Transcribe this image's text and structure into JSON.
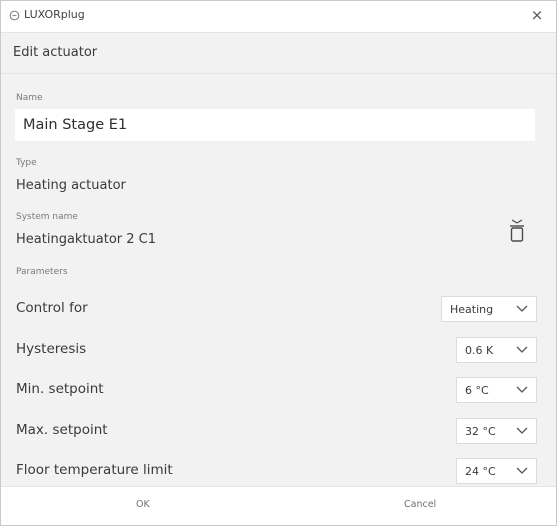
{
  "window": {
    "title": "LUXORplug",
    "close_glyph": "×",
    "app_icon": "luxorplug-icon",
    "close_icon": "close-icon"
  },
  "dialog": {
    "title": "Edit actuator"
  },
  "form": {
    "name_label": "Name",
    "name_value": "Main Stage E1",
    "type_label": "Type",
    "type_value": "Heating actuator",
    "system_name_label": "System name",
    "system_name_value": "Heatingaktuator 2 C1",
    "delete_icon": "trash-icon"
  },
  "parameters": {
    "label": "Parameters",
    "rows": [
      {
        "label": "Control for",
        "value": "Heating"
      },
      {
        "label": "Hysteresis",
        "value": "0.6 K"
      },
      {
        "label": "Min. setpoint",
        "value": "6 °C"
      },
      {
        "label": "Max. setpoint",
        "value": "32 °C"
      },
      {
        "label": "Floor temperature limit",
        "value": "24 °C"
      }
    ]
  },
  "footer": {
    "ok_label": "OK",
    "cancel_label": "Cancel"
  },
  "colors": {
    "panel_bg": "#f2f2f2",
    "text": "#3a3a3a",
    "muted": "#7a7a7a"
  }
}
